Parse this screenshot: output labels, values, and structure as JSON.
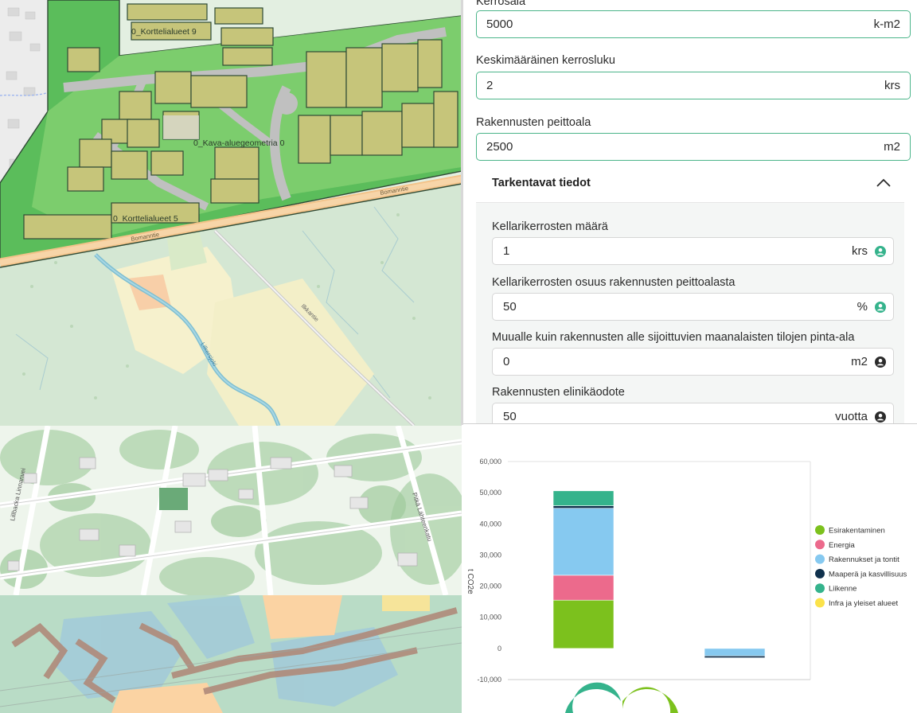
{
  "map_top": {
    "labels": {
      "kortteli9": "0_Korttelialueet 9",
      "kortteli5": "0_Korttelialueet 5",
      "katualue": "0_Kava-aluegeometria 0",
      "road1": "Bomanntie",
      "road2": "Bomanntie",
      "road3": "Ilkkantie",
      "river": "Lilkersjoki"
    }
  },
  "map_mid": {
    "labels": {
      "road_left": "Lillbacka Linnanvei",
      "road_right": "Pitkä Lähteenkatu"
    }
  },
  "form": {
    "kerrosala": {
      "label": "Kerrosala",
      "value": "5000",
      "unit": "k-m2"
    },
    "kerrosluku": {
      "label": "Keskimääräinen kerrosluku",
      "value": "2",
      "unit": "krs"
    },
    "peittoala": {
      "label": "Rakennusten peittoala",
      "value": "2500",
      "unit": "m2"
    },
    "section": {
      "title": "Tarkentavat tiedot"
    },
    "details": [
      {
        "label": "Kellarikerrosten määrä",
        "value": "1",
        "unit": "krs",
        "icon": "user-circle-green-icon"
      },
      {
        "label": "Kellarikerrosten osuus rakennusten peittoalasta",
        "value": "50",
        "unit": "%",
        "icon": "user-circle-green-icon"
      },
      {
        "label": "Muualle kuin rakennusten alle sijoittuvien maanalaisten tilojen pinta-ala",
        "value": "0",
        "unit": "m2",
        "icon": "user-circle-dark-icon"
      },
      {
        "label": "Rakennusten elinikäodote",
        "value": "50",
        "unit": "vuotta",
        "icon": "user-circle-dark-icon"
      }
    ]
  },
  "colors": {
    "accent": "#4bb58a",
    "esirakentaminen": "#7cc11d",
    "energia": "#ec6a8c",
    "rakennukset": "#86c9f0",
    "maapera": "#10314d",
    "liikenne": "#35b38c",
    "infra": "#fbe24a"
  },
  "chart_data": {
    "type": "bar",
    "stacked": true,
    "ylabel": "t CO2e",
    "ylim": [
      -10000,
      60000
    ],
    "yticks": [
      -10000,
      0,
      10000,
      20000,
      30000,
      40000,
      50000,
      60000
    ],
    "ytick_labels": [
      "-10,000",
      "0",
      "10,000",
      "20,000",
      "30,000",
      "40,000",
      "50,000",
      "60,000"
    ],
    "grid": false,
    "legend_position": "right",
    "categories": [
      "",
      ""
    ],
    "series": [
      {
        "name": "Esirakentaminen",
        "color": "#7cc11d",
        "values": [
          15500,
          0
        ]
      },
      {
        "name": "Energia",
        "color": "#ec6a8c",
        "values": [
          8000,
          0
        ]
      },
      {
        "name": "Rakennukset ja tontit",
        "color": "#86c9f0",
        "values": [
          21500,
          -2400
        ]
      },
      {
        "name": "Maaperä ja kasvillisuus",
        "color": "#10314d",
        "values": [
          800,
          -600
        ]
      },
      {
        "name": "Liikenne",
        "color": "#35b38c",
        "values": [
          4800,
          0
        ]
      },
      {
        "name": "Infra ja yleiset alueet",
        "color": "#fbe24a",
        "values": [
          0,
          0
        ]
      }
    ]
  }
}
